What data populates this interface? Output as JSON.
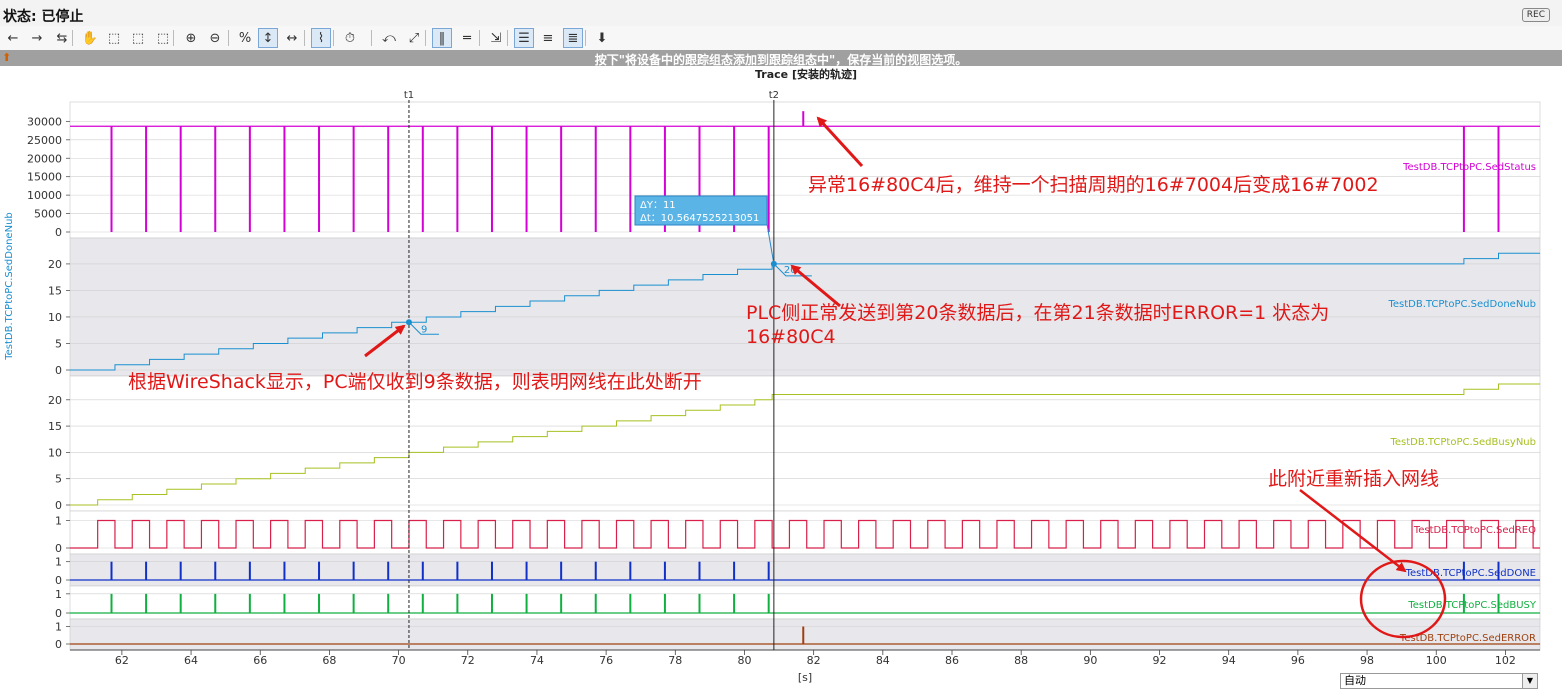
{
  "status": {
    "label": "状态: 已停止",
    "rec": "REC"
  },
  "toolbar": {
    "icons": [
      "back-icon",
      "forward-icon",
      "reset-view-icon",
      "hand-icon",
      "zoom-rect-icon",
      "zoom-x-icon",
      "zoom-y-icon",
      "zoom-in-icon",
      "zoom-out-icon",
      "zoom-100-icon",
      "scale-y-icon",
      "scale-x-icon",
      "chart-icon",
      "time-icon",
      "line-icon",
      "fit-icon",
      "measure-x-icon",
      "measure-y-icon",
      "export-icon",
      "legend-icon",
      "align-left-icon",
      "align-right-icon",
      "settings-icon"
    ],
    "labels": [
      "←",
      "→",
      "⇆",
      "✋",
      "⬚",
      "⬚",
      "⬚",
      "⊕",
      "⊖",
      "%",
      "↕",
      "↔",
      "⌇",
      "⏱",
      "⤺",
      "⤢",
      "‖",
      "═",
      "⇲",
      "☰",
      "≡",
      "≣",
      "⬇"
    ]
  },
  "hint": "按下\"将设备中的跟踪组态添加到跟踪组态中\"，保存当前的视图选项。",
  "chart_title": "Trace [安装的轨迹]",
  "cursors": {
    "t1": "t1",
    "t2": "t2"
  },
  "tooltip": {
    "dy": "ΔY：11",
    "dt": "Δt：10.5647525213051"
  },
  "point_labels": {
    "p9": "9",
    "p20": "20"
  },
  "y_axis_label": "TestDB.TCPtoPC.SedDoneNub",
  "x_unit": "[s]",
  "annotations": {
    "a1": "异常16#80C4后，维持一个扫描周期的16#7004后变成16#7002",
    "a2_line1": "PLC侧正常发送到第20条数据后，在第21条数据时ERROR=1 状态为",
    "a2_line2": "16#80C4",
    "a3": "根据WireShack显示，PC端仅收到9条数据，则表明网线在此处断开",
    "a4": "此附近重新插入网线"
  },
  "zoom_select": {
    "value": "自动"
  },
  "colors": {
    "status": "#d400d4",
    "done_nub": "#1a8fd0",
    "busy_nub": "#a8c020",
    "req": "#d8204a",
    "done": "#1030c8",
    "busy": "#10b040",
    "error": "#a04010",
    "annotation": "#e01818"
  },
  "chart_data": {
    "type": "line",
    "x_ticks": [
      62,
      64,
      66,
      68,
      70,
      72,
      74,
      76,
      78,
      80,
      82,
      84,
      86,
      88,
      90,
      92,
      94,
      96,
      98,
      100,
      102
    ],
    "xlim": [
      60.5,
      103
    ],
    "cursor_t1": 70.3,
    "cursor_t2": 80.85,
    "series": [
      {
        "name": "TestDB.TCPtoPC.SedStatus",
        "yticks": [
          0,
          5000,
          10000,
          15000,
          20000,
          25000,
          30000
        ],
        "ylim": [
          0,
          32000
        ],
        "baseline": 28674,
        "pulse_value": 0,
        "spike": [
          81.7,
          32768
        ],
        "pulses": [
          61.7,
          62.7,
          63.7,
          64.7,
          65.7,
          66.7,
          67.7,
          68.7,
          69.7,
          70.7,
          71.7,
          72.7,
          73.7,
          74.7,
          75.7,
          76.7,
          77.7,
          78.7,
          79.7,
          80.7,
          100.8,
          101.8
        ]
      },
      {
        "name": "TestDB.TCPtoPC.SedDoneNub",
        "yticks": [
          0,
          5,
          10,
          15,
          20
        ],
        "ylim": [
          0,
          23
        ],
        "steps": [
          [
            60.5,
            0
          ],
          [
            61.8,
            1
          ],
          [
            62.8,
            2
          ],
          [
            63.8,
            3
          ],
          [
            64.8,
            4
          ],
          [
            65.8,
            5
          ],
          [
            66.8,
            6
          ],
          [
            67.8,
            7
          ],
          [
            68.8,
            8
          ],
          [
            69.8,
            9
          ],
          [
            70.8,
            10
          ],
          [
            71.8,
            11
          ],
          [
            72.8,
            12
          ],
          [
            73.8,
            13
          ],
          [
            74.8,
            14
          ],
          [
            75.8,
            15
          ],
          [
            76.8,
            16
          ],
          [
            77.8,
            17
          ],
          [
            78.8,
            18
          ],
          [
            79.8,
            19
          ],
          [
            80.8,
            20
          ],
          [
            100.8,
            21
          ],
          [
            101.8,
            22
          ],
          [
            103,
            22
          ]
        ]
      },
      {
        "name": "TestDB.TCPtoPC.SedBusyNub",
        "yticks": [
          0,
          5,
          10,
          15,
          20
        ],
        "ylim": [
          0,
          23
        ],
        "steps": [
          [
            60.5,
            0
          ],
          [
            61.3,
            1
          ],
          [
            62.3,
            2
          ],
          [
            63.3,
            3
          ],
          [
            64.3,
            4
          ],
          [
            65.3,
            5
          ],
          [
            66.3,
            6
          ],
          [
            67.3,
            7
          ],
          [
            68.3,
            8
          ],
          [
            69.3,
            9
          ],
          [
            70.3,
            10
          ],
          [
            71.3,
            11
          ],
          [
            72.3,
            12
          ],
          [
            73.3,
            13
          ],
          [
            74.3,
            14
          ],
          [
            75.3,
            15
          ],
          [
            76.3,
            16
          ],
          [
            77.3,
            17
          ],
          [
            78.3,
            18
          ],
          [
            79.3,
            19
          ],
          [
            80.3,
            20
          ],
          [
            80.8,
            21
          ],
          [
            100.8,
            22
          ],
          [
            101.8,
            23
          ],
          [
            103,
            23
          ]
        ]
      },
      {
        "name": "TestDB.TCPtoPC.SedREQ",
        "yticks": [
          0,
          1
        ],
        "ylim": [
          0,
          1.2
        ],
        "period": 1.0,
        "start": 61.3,
        "end": 103
      },
      {
        "name": "TestDB.TCPtoPC.SedDONE",
        "yticks": [
          0,
          1
        ],
        "ylim": [
          0,
          1.2
        ],
        "pulses": [
          61.7,
          62.7,
          63.7,
          64.7,
          65.7,
          66.7,
          67.7,
          68.7,
          69.7,
          70.7,
          71.7,
          72.7,
          73.7,
          74.7,
          75.7,
          76.7,
          77.7,
          78.7,
          79.7,
          80.7,
          100.8,
          101.8
        ]
      },
      {
        "name": "TestDB.TCPtoPC.SedBUSY",
        "yticks": [
          0,
          1
        ],
        "ylim": [
          0,
          1.2
        ],
        "pulses": [
          61.7,
          62.7,
          63.7,
          64.7,
          65.7,
          66.7,
          67.7,
          68.7,
          69.7,
          70.7,
          71.7,
          72.7,
          73.7,
          74.7,
          75.7,
          76.7,
          77.7,
          78.7,
          79.7,
          80.7,
          100.8,
          101.8
        ]
      },
      {
        "name": "TestDB.TCPtoPC.SedERROR",
        "yticks": [
          0,
          1
        ],
        "ylim": [
          0,
          1.2
        ],
        "pulses": [
          81.7
        ]
      }
    ]
  }
}
